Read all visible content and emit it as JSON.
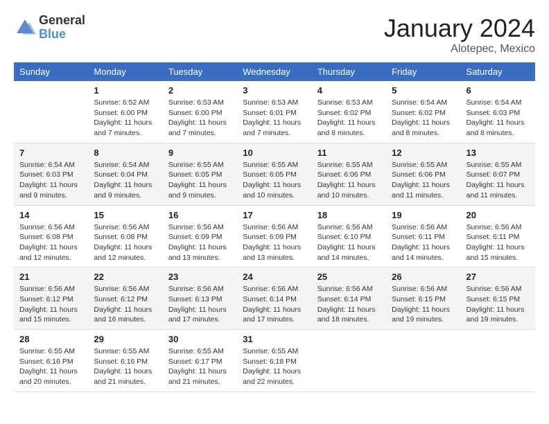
{
  "logo": {
    "text_general": "General",
    "text_blue": "Blue"
  },
  "title": "January 2024",
  "location": "Alotepec, Mexico",
  "weekdays": [
    "Sunday",
    "Monday",
    "Tuesday",
    "Wednesday",
    "Thursday",
    "Friday",
    "Saturday"
  ],
  "weeks": [
    [
      {
        "day": "",
        "info": ""
      },
      {
        "day": "1",
        "info": "Sunrise: 6:52 AM\nSunset: 6:00 PM\nDaylight: 11 hours\nand 7 minutes."
      },
      {
        "day": "2",
        "info": "Sunrise: 6:53 AM\nSunset: 6:00 PM\nDaylight: 11 hours\nand 7 minutes."
      },
      {
        "day": "3",
        "info": "Sunrise: 6:53 AM\nSunset: 6:01 PM\nDaylight: 11 hours\nand 7 minutes."
      },
      {
        "day": "4",
        "info": "Sunrise: 6:53 AM\nSunset: 6:02 PM\nDaylight: 11 hours\nand 8 minutes."
      },
      {
        "day": "5",
        "info": "Sunrise: 6:54 AM\nSunset: 6:02 PM\nDaylight: 11 hours\nand 8 minutes."
      },
      {
        "day": "6",
        "info": "Sunrise: 6:54 AM\nSunset: 6:03 PM\nDaylight: 11 hours\nand 8 minutes."
      }
    ],
    [
      {
        "day": "7",
        "info": "Sunrise: 6:54 AM\nSunset: 6:03 PM\nDaylight: 11 hours\nand 9 minutes."
      },
      {
        "day": "8",
        "info": "Sunrise: 6:54 AM\nSunset: 6:04 PM\nDaylight: 11 hours\nand 9 minutes."
      },
      {
        "day": "9",
        "info": "Sunrise: 6:55 AM\nSunset: 6:05 PM\nDaylight: 11 hours\nand 9 minutes."
      },
      {
        "day": "10",
        "info": "Sunrise: 6:55 AM\nSunset: 6:05 PM\nDaylight: 11 hours\nand 10 minutes."
      },
      {
        "day": "11",
        "info": "Sunrise: 6:55 AM\nSunset: 6:06 PM\nDaylight: 11 hours\nand 10 minutes."
      },
      {
        "day": "12",
        "info": "Sunrise: 6:55 AM\nSunset: 6:06 PM\nDaylight: 11 hours\nand 11 minutes."
      },
      {
        "day": "13",
        "info": "Sunrise: 6:55 AM\nSunset: 6:07 PM\nDaylight: 11 hours\nand 11 minutes."
      }
    ],
    [
      {
        "day": "14",
        "info": "Sunrise: 6:56 AM\nSunset: 6:08 PM\nDaylight: 11 hours\nand 12 minutes."
      },
      {
        "day": "15",
        "info": "Sunrise: 6:56 AM\nSunset: 6:08 PM\nDaylight: 11 hours\nand 12 minutes."
      },
      {
        "day": "16",
        "info": "Sunrise: 6:56 AM\nSunset: 6:09 PM\nDaylight: 11 hours\nand 13 minutes."
      },
      {
        "day": "17",
        "info": "Sunrise: 6:56 AM\nSunset: 6:09 PM\nDaylight: 11 hours\nand 13 minutes."
      },
      {
        "day": "18",
        "info": "Sunrise: 6:56 AM\nSunset: 6:10 PM\nDaylight: 11 hours\nand 14 minutes."
      },
      {
        "day": "19",
        "info": "Sunrise: 6:56 AM\nSunset: 6:11 PM\nDaylight: 11 hours\nand 14 minutes."
      },
      {
        "day": "20",
        "info": "Sunrise: 6:56 AM\nSunset: 6:11 PM\nDaylight: 11 hours\nand 15 minutes."
      }
    ],
    [
      {
        "day": "21",
        "info": "Sunrise: 6:56 AM\nSunset: 6:12 PM\nDaylight: 11 hours\nand 15 minutes."
      },
      {
        "day": "22",
        "info": "Sunrise: 6:56 AM\nSunset: 6:12 PM\nDaylight: 11 hours\nand 16 minutes."
      },
      {
        "day": "23",
        "info": "Sunrise: 6:56 AM\nSunset: 6:13 PM\nDaylight: 11 hours\nand 17 minutes."
      },
      {
        "day": "24",
        "info": "Sunrise: 6:56 AM\nSunset: 6:14 PM\nDaylight: 11 hours\nand 17 minutes."
      },
      {
        "day": "25",
        "info": "Sunrise: 6:56 AM\nSunset: 6:14 PM\nDaylight: 11 hours\nand 18 minutes."
      },
      {
        "day": "26",
        "info": "Sunrise: 6:56 AM\nSunset: 6:15 PM\nDaylight: 11 hours\nand 19 minutes."
      },
      {
        "day": "27",
        "info": "Sunrise: 6:56 AM\nSunset: 6:15 PM\nDaylight: 11 hours\nand 19 minutes."
      }
    ],
    [
      {
        "day": "28",
        "info": "Sunrise: 6:55 AM\nSunset: 6:16 PM\nDaylight: 11 hours\nand 20 minutes."
      },
      {
        "day": "29",
        "info": "Sunrise: 6:55 AM\nSunset: 6:16 PM\nDaylight: 11 hours\nand 21 minutes."
      },
      {
        "day": "30",
        "info": "Sunrise: 6:55 AM\nSunset: 6:17 PM\nDaylight: 11 hours\nand 21 minutes."
      },
      {
        "day": "31",
        "info": "Sunrise: 6:55 AM\nSunset: 6:18 PM\nDaylight: 11 hours\nand 22 minutes."
      },
      {
        "day": "",
        "info": ""
      },
      {
        "day": "",
        "info": ""
      },
      {
        "day": "",
        "info": ""
      }
    ]
  ]
}
